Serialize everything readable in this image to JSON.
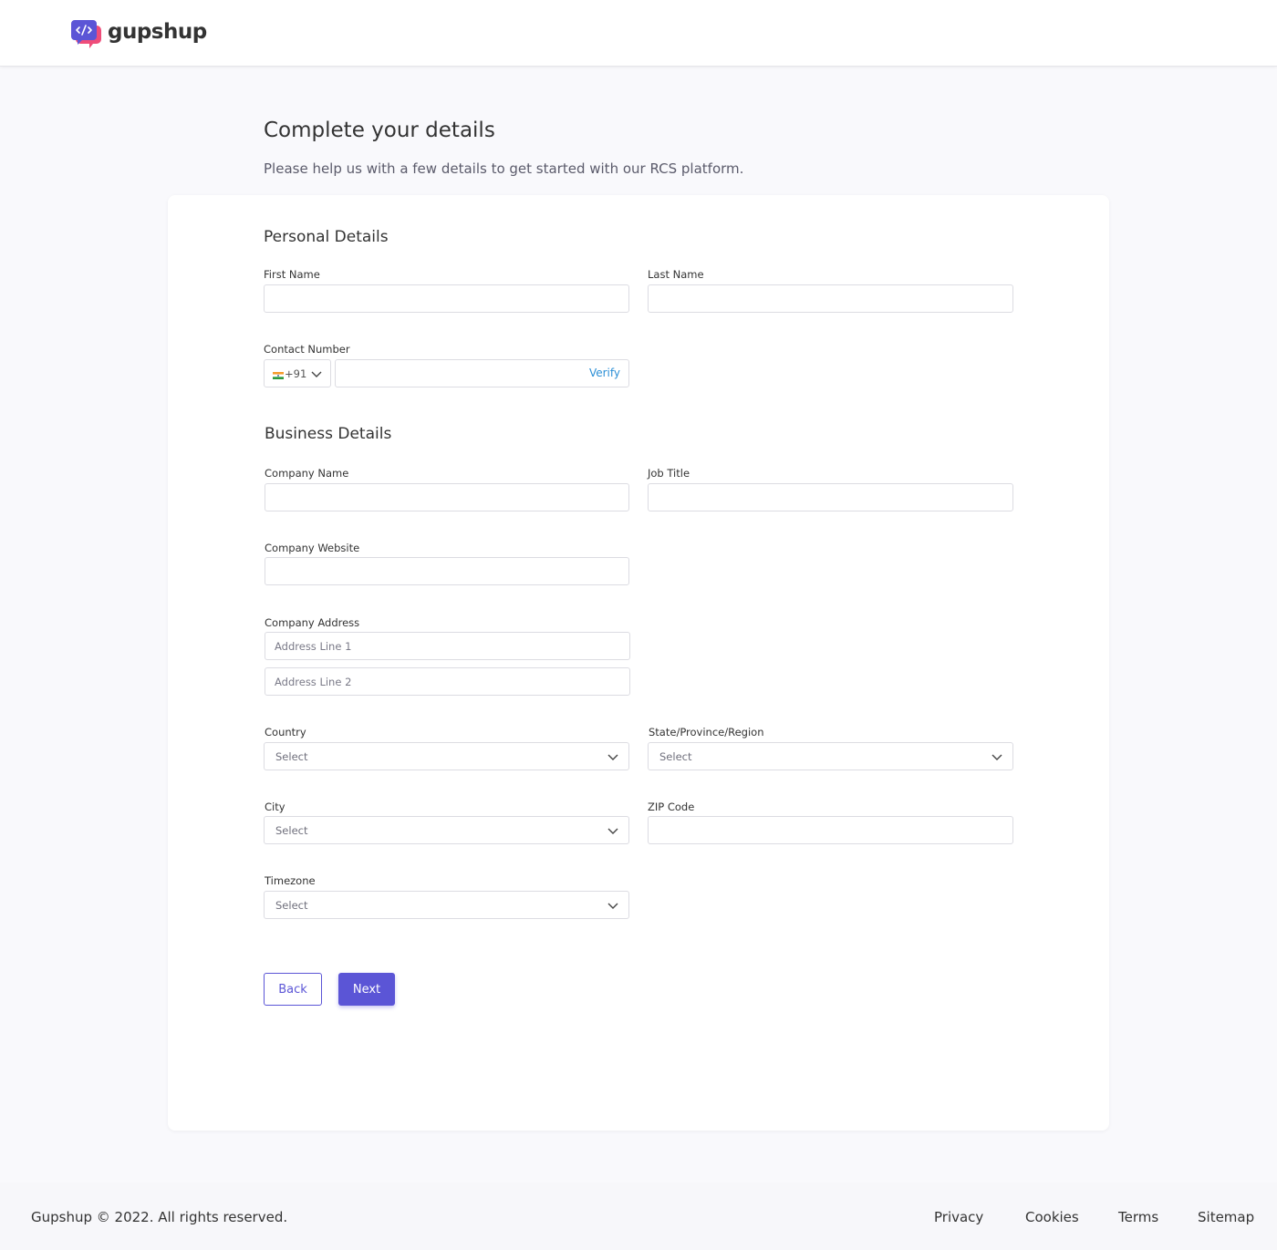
{
  "brand": {
    "name": "gupshup",
    "colors": {
      "primary": "#5b55d6",
      "logo_pink": "#ef4d7a",
      "link": "#2b8fd6"
    }
  },
  "page": {
    "title": "Complete your details",
    "subtitle": "Please help us with a few details to get started with our RCS platform."
  },
  "personal": {
    "title": "Personal Details",
    "first_name_label": "First Name",
    "last_name_label": "Last Name",
    "contact_label": "Contact Number",
    "country_code": "+91",
    "verify_label": "Verify"
  },
  "business": {
    "title": "Business Details",
    "company_name_label": "Company Name",
    "job_title_label": "Job Title",
    "company_website_label": "Company Website",
    "company_address_label": "Company Address",
    "address_line1_placeholder": "Address Line 1",
    "address_line2_placeholder": "Address Line 2",
    "country_label": "Country",
    "country_value": "Select",
    "state_label": "State/Province/Region",
    "state_value": "Select",
    "city_label": "City",
    "city_value": "Select",
    "zip_label": "ZIP Code",
    "timezone_label": "Timezone",
    "timezone_value": "Select"
  },
  "actions": {
    "back_label": "Back",
    "next_label": "Next"
  },
  "footer": {
    "copyright": "Gupshup © 2022. All rights reserved.",
    "links": [
      "Privacy",
      "Cookies",
      "Terms",
      "Sitemap"
    ]
  },
  "icons": {
    "logo": "chat-bubble-code-icon",
    "dropdown": "chevron-down-icon",
    "flag": "india-flag-icon"
  }
}
